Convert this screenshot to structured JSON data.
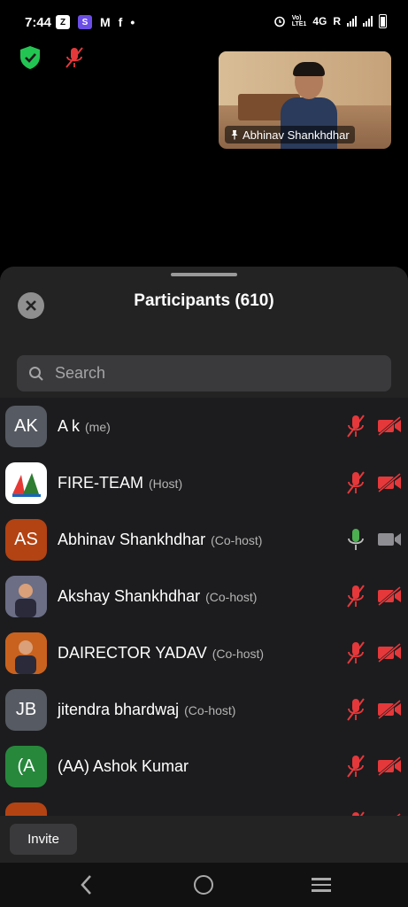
{
  "status_bar": {
    "time": "7:44",
    "left_icons": [
      "Z",
      "S",
      "M",
      "f",
      "•"
    ],
    "network_label_top": "Vo)",
    "network_label_bottom": "LTE1",
    "network_4g": "4G",
    "roaming": "R"
  },
  "video": {
    "participant_name": "Abhinav Shankhdhar"
  },
  "panel": {
    "title": "Participants (610)",
    "search_placeholder": "Search"
  },
  "participants": [
    {
      "initials": "AK",
      "name": "A k",
      "role": "(me)",
      "avatar_color": "#565a62",
      "mic": "muted",
      "video": "off"
    },
    {
      "initials": "",
      "name": "FIRE-TEAM",
      "role": "(Host)",
      "avatar_color": "#ffffff",
      "mic": "muted",
      "video": "off",
      "avatar_kind": "logo"
    },
    {
      "initials": "AS",
      "name": "Abhinav Shankhdhar",
      "role": "(Co-host)",
      "avatar_color": "#b34313",
      "mic": "on",
      "video": "on"
    },
    {
      "initials": "",
      "name": "Akshay Shankhdhar",
      "role": "(Co-host)",
      "avatar_color": "#6b6e85",
      "mic": "muted",
      "video": "off",
      "avatar_kind": "photo"
    },
    {
      "initials": "",
      "name": "DAIRECTOR YADAV",
      "role": "(Co-host)",
      "avatar_color": "#c9621e",
      "mic": "muted",
      "video": "off",
      "avatar_kind": "photo"
    },
    {
      "initials": "JB",
      "name": "jitendra bhardwaj",
      "role": "(Co-host)",
      "avatar_color": "#565a62",
      "mic": "muted",
      "video": "off"
    },
    {
      "initials": "(A",
      "name": "(AA) Ashok Kumar",
      "role": "",
      "avatar_color": "#27883c",
      "mic": "muted",
      "video": "off"
    },
    {
      "initials": "",
      "name": "",
      "role": "",
      "avatar_color": "#b34313",
      "mic": "muted",
      "video": "off"
    }
  ],
  "bottom": {
    "invite_label": "Invite"
  },
  "colors": {
    "muted_red": "#e5383b",
    "mic_green": "#4caf50",
    "shield_green": "#23c552"
  }
}
